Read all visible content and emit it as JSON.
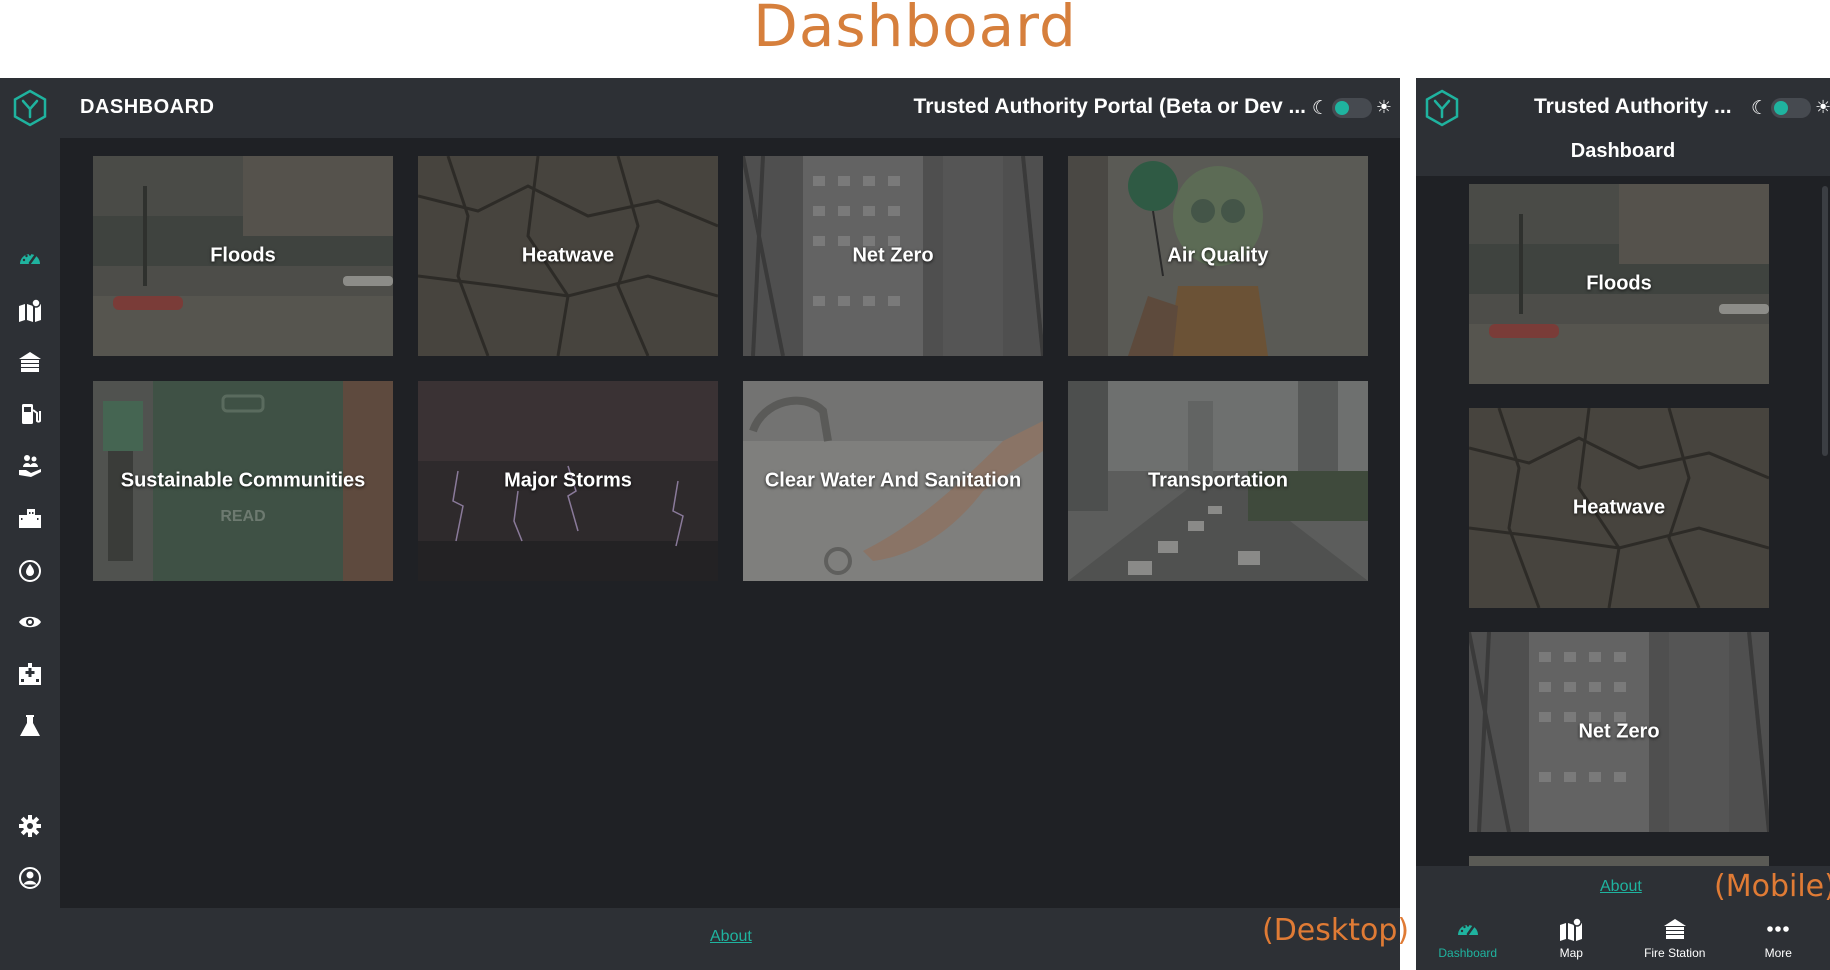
{
  "page_title": "Dashboard",
  "annotations": {
    "desktop": "(Desktop)",
    "mobile": "(Mobile)"
  },
  "colors": {
    "accent": "#1fb39f",
    "annotation": "#e07b35",
    "panel": "#2d3035",
    "content": "#1f2125"
  },
  "desktop": {
    "header": {
      "title": "DASHBOARD",
      "portal_title": "Trusted Authority Portal (Beta or Dev ..."
    },
    "sidebar": {
      "items": [
        {
          "icon": "dashboard-gauge-icon",
          "active": true
        },
        {
          "icon": "map-icon"
        },
        {
          "icon": "fire-station-icon"
        },
        {
          "icon": "fuel-pump-icon"
        },
        {
          "icon": "community-hands-icon"
        },
        {
          "icon": "buildings-icon"
        },
        {
          "icon": "water-drop-icon"
        },
        {
          "icon": "eye-icon"
        },
        {
          "icon": "hospital-icon"
        },
        {
          "icon": "flask-icon"
        },
        {
          "icon": "settings-gear-icon"
        },
        {
          "icon": "user-account-icon"
        }
      ]
    },
    "tiles": [
      {
        "label": "Floods"
      },
      {
        "label": "Heatwave"
      },
      {
        "label": "Net Zero"
      },
      {
        "label": "Air Quality"
      },
      {
        "label": "Sustainable Communities"
      },
      {
        "label": "Major Storms"
      },
      {
        "label": "Clear Water And Sanitation"
      },
      {
        "label": "Transportation"
      }
    ],
    "footer": {
      "about": "About"
    }
  },
  "mobile": {
    "header": {
      "portal_title": "Trusted Authority ...",
      "subtitle": "Dashboard"
    },
    "tiles": [
      {
        "label": "Floods"
      },
      {
        "label": "Heatwave"
      },
      {
        "label": "Net Zero"
      }
    ],
    "footer": {
      "about": "About",
      "nav": [
        {
          "label": "Dashboard",
          "icon": "dashboard-gauge-icon",
          "active": true
        },
        {
          "label": "Map",
          "icon": "map-icon"
        },
        {
          "label": "Fire Station",
          "icon": "fire-station-icon"
        },
        {
          "label": "More",
          "icon": "more-dots-icon"
        }
      ]
    }
  }
}
